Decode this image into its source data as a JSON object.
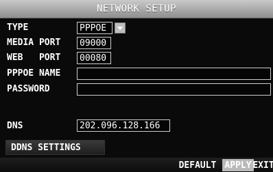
{
  "title": "NETWORK SETUP",
  "fields": {
    "type": {
      "label": "TYPE",
      "value": "PPPOE"
    },
    "media_port": {
      "label": "MEDIA PORT",
      "value": "09000"
    },
    "web_port": {
      "label": "WEB   PORT",
      "value": "00080"
    },
    "pppoe_name": {
      "label": "PPPOE NAME",
      "value": ""
    },
    "password": {
      "label": "PASSWORD",
      "value": ""
    },
    "dns": {
      "label": "DNS",
      "value": "202.096.128.166"
    }
  },
  "buttons": {
    "ddns_settings": "DDNS SETTINGS",
    "default": "DEFAULT",
    "apply": "APPLY",
    "exit": "EXIT"
  },
  "icons": {
    "dropdown": "chevron-down-icon"
  },
  "colors": {
    "titlebar": "#a9a9a9",
    "active_button": "#b9b9b9"
  }
}
